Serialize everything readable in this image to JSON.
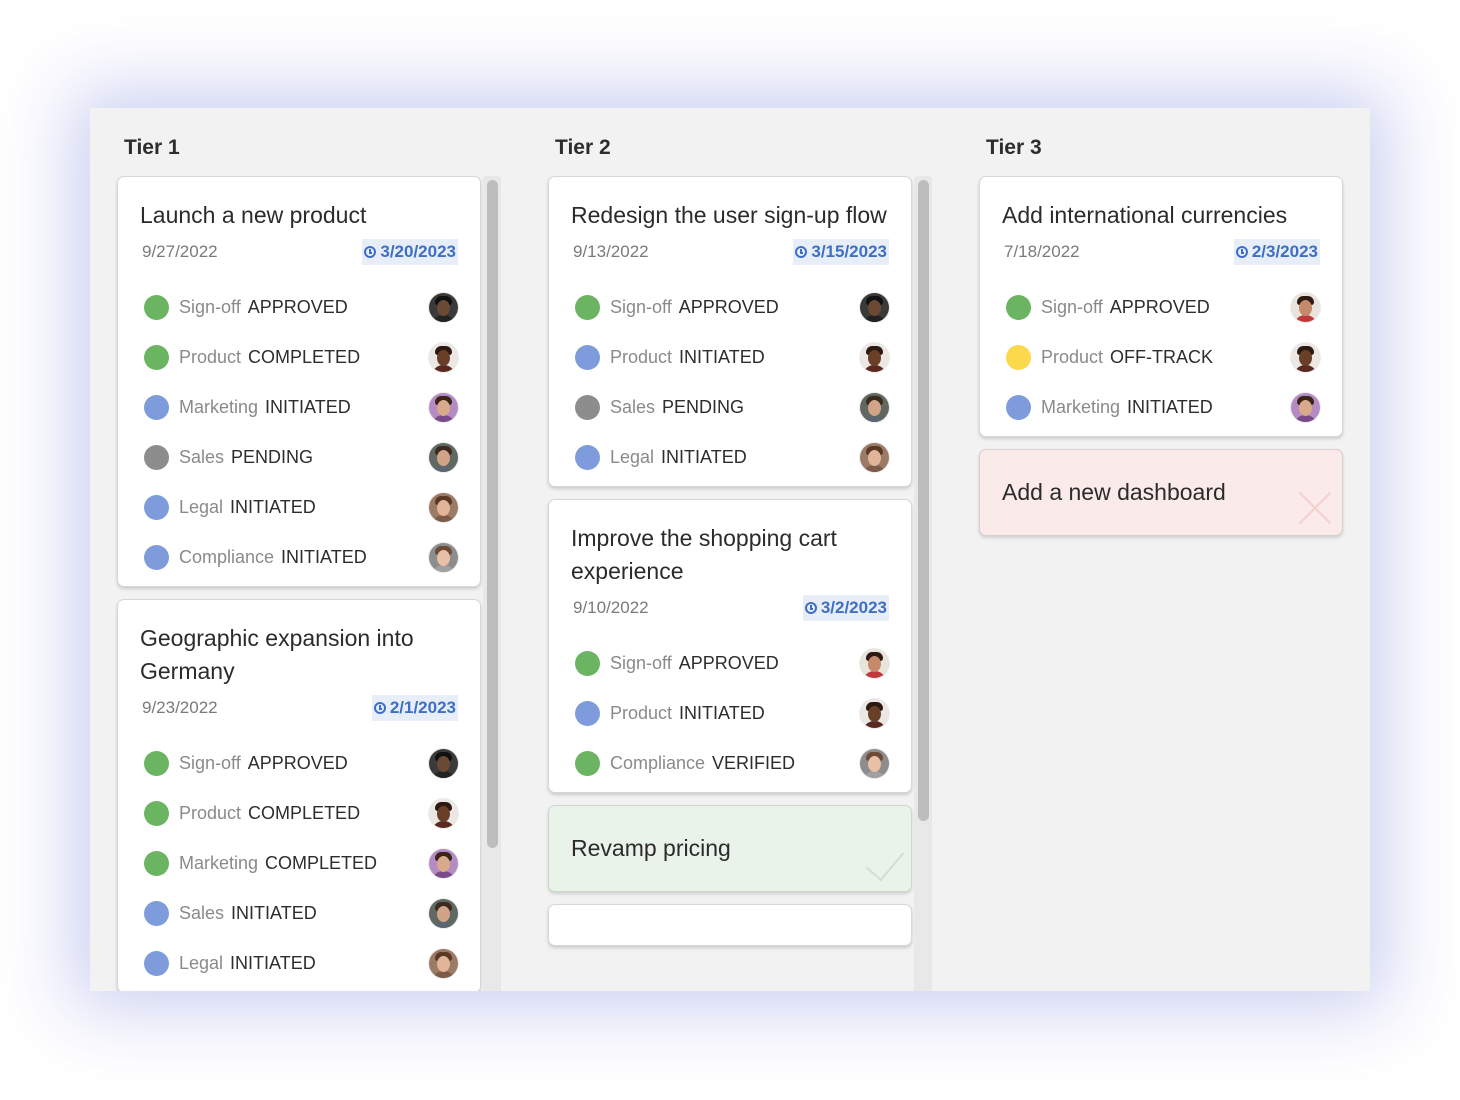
{
  "columns": [
    {
      "title": "Tier 1",
      "cards": [
        {
          "title": "Launch a new product",
          "start_date": "9/27/2022",
          "due_date": "3/20/2023",
          "items": [
            {
              "label": "Sign-off",
              "status": "APPROVED",
              "dot_color": "#6ab462",
              "avatar": "man-dark-glasses"
            },
            {
              "label": "Product",
              "status": "COMPLETED",
              "dot_color": "#6ab462",
              "avatar": "woman-curly-dark"
            },
            {
              "label": "Marketing",
              "status": "INITIATED",
              "dot_color": "#7e9bdc",
              "avatar": "woman-dark-hair-purple"
            },
            {
              "label": "Sales",
              "status": "PENDING",
              "dot_color": "#8d8d8d",
              "avatar": "man-beard"
            },
            {
              "label": "Legal",
              "status": "INITIATED",
              "dot_color": "#7e9bdc",
              "avatar": "man-smiling"
            },
            {
              "label": "Compliance",
              "status": "INITIATED",
              "dot_color": "#7e9bdc",
              "avatar": "man-light"
            }
          ]
        },
        {
          "title": "Geographic expansion into Germany",
          "start_date": "9/23/2022",
          "due_date": "2/1/2023",
          "items": [
            {
              "label": "Sign-off",
              "status": "APPROVED",
              "dot_color": "#6ab462",
              "avatar": "man-dark-glasses"
            },
            {
              "label": "Product",
              "status": "COMPLETED",
              "dot_color": "#6ab462",
              "avatar": "woman-curly-dark"
            },
            {
              "label": "Marketing",
              "status": "COMPLETED",
              "dot_color": "#6ab462",
              "avatar": "woman-dark-hair-purple"
            },
            {
              "label": "Sales",
              "status": "INITIATED",
              "dot_color": "#7e9bdc",
              "avatar": "man-beard"
            },
            {
              "label": "Legal",
              "status": "INITIATED",
              "dot_color": "#7e9bdc",
              "avatar": "man-smiling"
            }
          ]
        }
      ]
    },
    {
      "title": "Tier 2",
      "cards": [
        {
          "title": "Redesign the user sign-up flow",
          "start_date": "9/13/2022",
          "due_date": "3/15/2023",
          "items": [
            {
              "label": "Sign-off",
              "status": "APPROVED",
              "dot_color": "#6ab462",
              "avatar": "man-dark-glasses"
            },
            {
              "label": "Product",
              "status": "INITIATED",
              "dot_color": "#7e9bdc",
              "avatar": "woman-curly-dark"
            },
            {
              "label": "Sales",
              "status": "PENDING",
              "dot_color": "#8d8d8d",
              "avatar": "man-beard"
            },
            {
              "label": "Legal",
              "status": "INITIATED",
              "dot_color": "#7e9bdc",
              "avatar": "man-smiling"
            }
          ]
        },
        {
          "title": "Improve the shopping cart experience",
          "start_date": "9/10/2022",
          "due_date": "3/2/2023",
          "items": [
            {
              "label": "Sign-off",
              "status": "APPROVED",
              "dot_color": "#6ab462",
              "avatar": "woman-red-top"
            },
            {
              "label": "Product",
              "status": "INITIATED",
              "dot_color": "#7e9bdc",
              "avatar": "woman-curly-dark"
            },
            {
              "label": "Compliance",
              "status": "VERIFIED",
              "dot_color": "#6ab462",
              "avatar": "man-light"
            }
          ]
        }
      ],
      "simple_cards": [
        {
          "title": "Revamp pricing",
          "variant": "done"
        }
      ]
    },
    {
      "title": "Tier 3",
      "cards": [
        {
          "title": "Add international currencies",
          "start_date": "7/18/2022",
          "due_date": "2/3/2023",
          "items": [
            {
              "label": "Sign-off",
              "status": "APPROVED",
              "dot_color": "#6ab462",
              "avatar": "woman-red-top"
            },
            {
              "label": "Product",
              "status": "OFF-TRACK",
              "dot_color": "#fbd94a",
              "avatar": "woman-curly-dark"
            },
            {
              "label": "Marketing",
              "status": "INITIATED",
              "dot_color": "#7e9bdc",
              "avatar": "woman-dark-hair-purple"
            }
          ]
        }
      ],
      "simple_cards": [
        {
          "title": "Add a new dashboard",
          "variant": "dismissable"
        }
      ]
    }
  ],
  "colors": {
    "approved_green": "#6ab462",
    "initiated_blue": "#7e9bdc",
    "pending_gray": "#8d8d8d",
    "off_track_yellow": "#fbd94a",
    "due_date_blue": "#3d6fc6"
  }
}
